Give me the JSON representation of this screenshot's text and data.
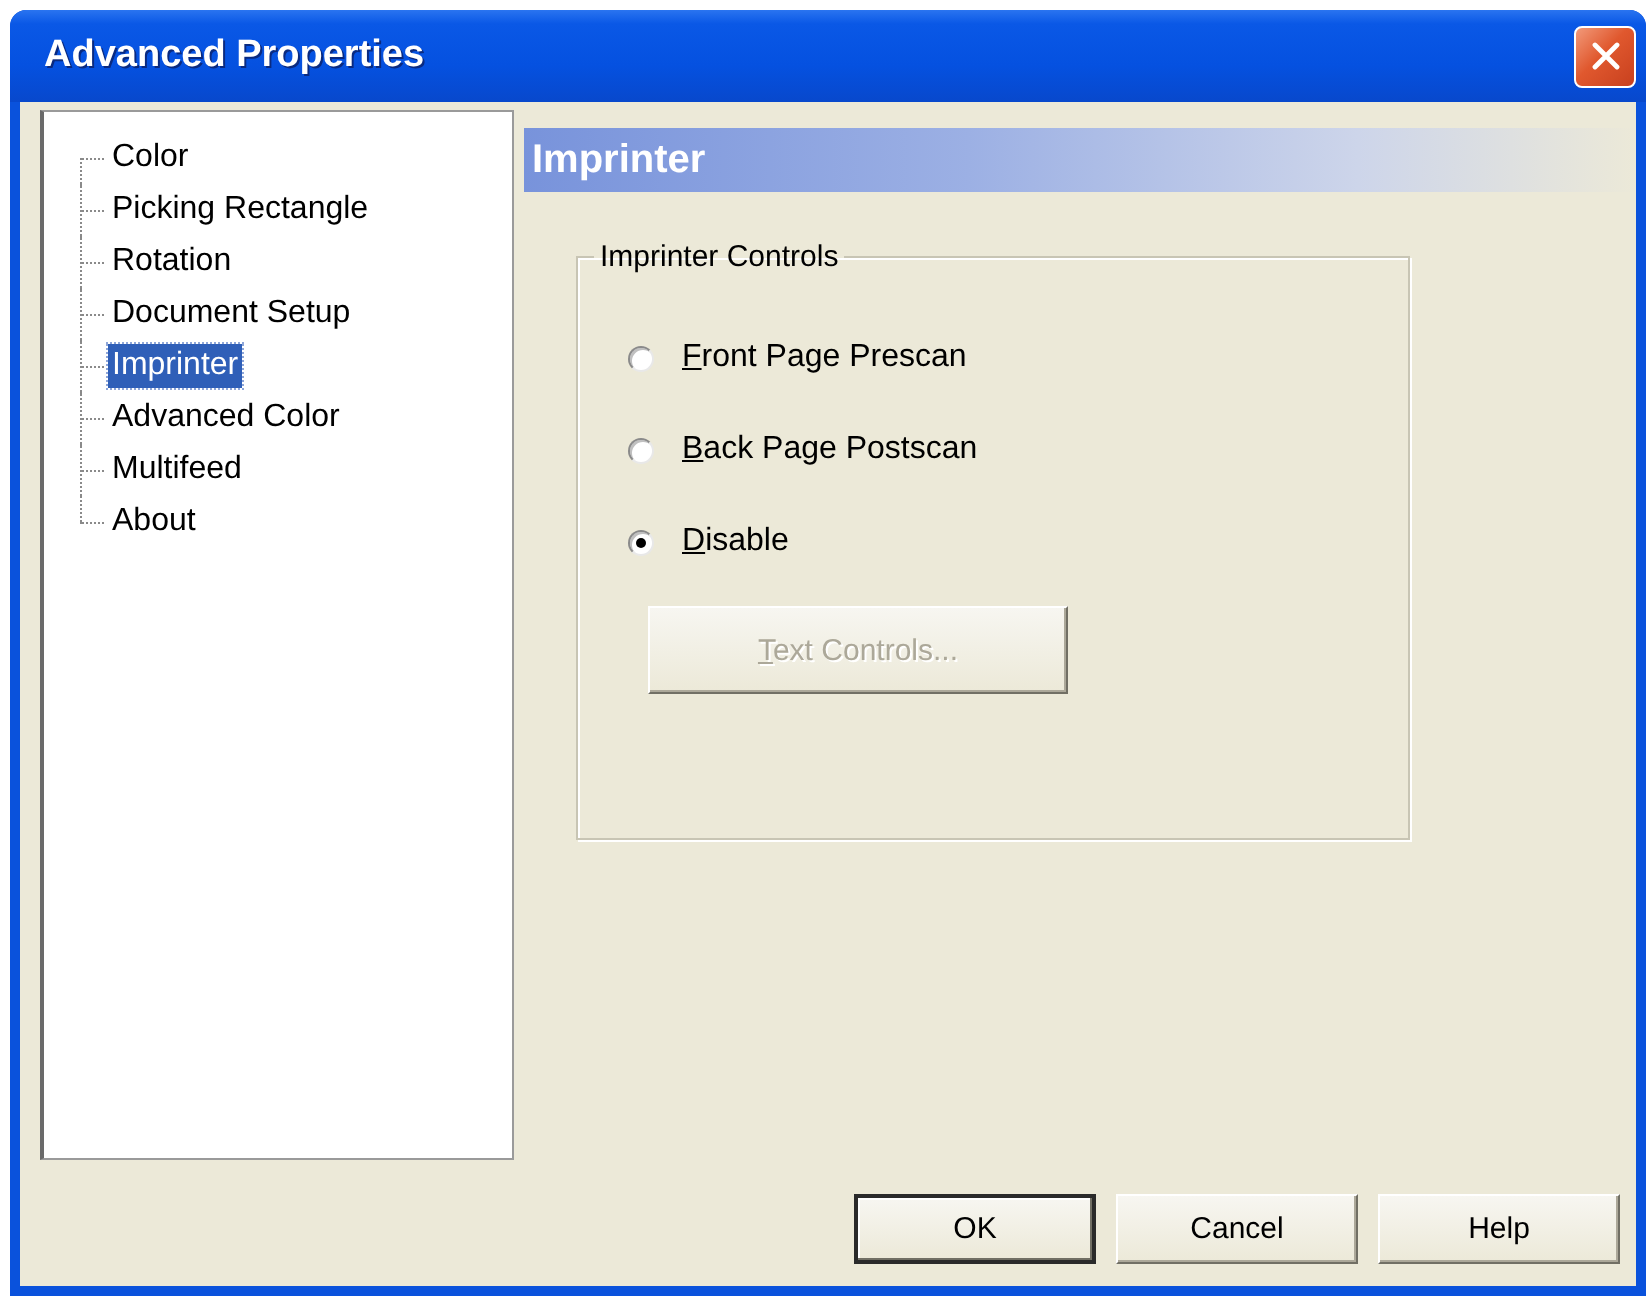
{
  "window": {
    "title": "Advanced Properties"
  },
  "tree": {
    "items": [
      {
        "label": "Color",
        "selected": false
      },
      {
        "label": "Picking Rectangle",
        "selected": false
      },
      {
        "label": "Rotation",
        "selected": false
      },
      {
        "label": "Document Setup",
        "selected": false
      },
      {
        "label": "Imprinter",
        "selected": true
      },
      {
        "label": "Advanced Color",
        "selected": false
      },
      {
        "label": "Multifeed",
        "selected": false
      },
      {
        "label": "About",
        "selected": false
      }
    ]
  },
  "panel": {
    "title": "Imprinter",
    "group": {
      "label": "Imprinter Controls",
      "options": [
        {
          "label": "Front Page Prescan",
          "mnemonic": true,
          "selected": false
        },
        {
          "label": "Back Page Postscan",
          "mnemonic": true,
          "selected": false
        },
        {
          "label": "Disable",
          "mnemonic": true,
          "selected": true
        }
      ],
      "button": {
        "label": "Text Controls...",
        "mnemonic": true,
        "disabled": true
      }
    }
  },
  "buttons": [
    {
      "label": "OK",
      "default": true
    },
    {
      "label": "Cancel",
      "default": false
    },
    {
      "label": "Help",
      "default": false
    }
  ]
}
